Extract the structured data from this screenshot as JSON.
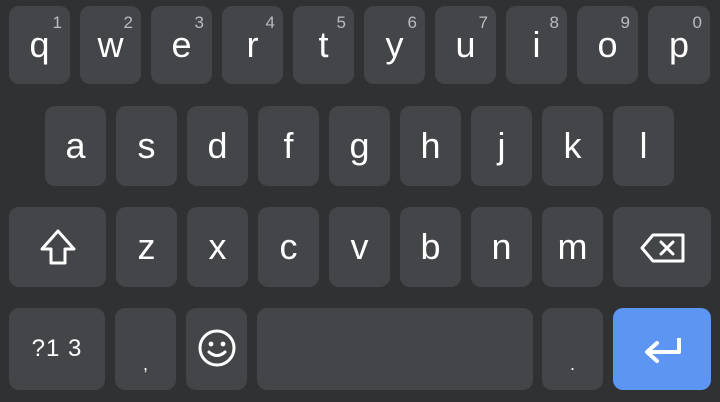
{
  "keyboard": {
    "row1": [
      {
        "letter": "q",
        "hint": "1"
      },
      {
        "letter": "w",
        "hint": "2"
      },
      {
        "letter": "e",
        "hint": "3"
      },
      {
        "letter": "r",
        "hint": "4"
      },
      {
        "letter": "t",
        "hint": "5"
      },
      {
        "letter": "y",
        "hint": "6"
      },
      {
        "letter": "u",
        "hint": "7"
      },
      {
        "letter": "i",
        "hint": "8"
      },
      {
        "letter": "o",
        "hint": "9"
      },
      {
        "letter": "p",
        "hint": "0"
      }
    ],
    "row2": [
      "a",
      "s",
      "d",
      "f",
      "g",
      "h",
      "j",
      "k",
      "l"
    ],
    "row3": [
      "z",
      "x",
      "c",
      "v",
      "b",
      "n",
      "m"
    ],
    "mode_label": "?1 3",
    "comma_label": ",",
    "period_label": ".",
    "icons": {
      "shift": "shift-arrow-icon",
      "backspace": "backspace-icon",
      "emoji": "emoji-icon",
      "enter": "enter-arrow-icon"
    },
    "colors": {
      "background": "#2f3133",
      "key": "#434548",
      "enter_key": "#5d95f2",
      "text": "#ffffff"
    }
  }
}
